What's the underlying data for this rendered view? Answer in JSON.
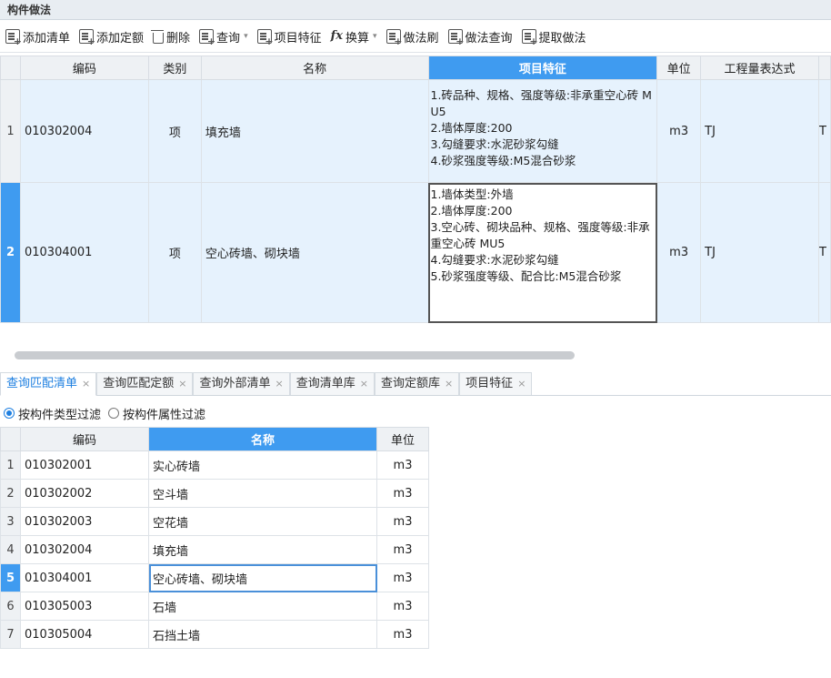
{
  "panel": {
    "title": "构件做法"
  },
  "toolbar": {
    "items": [
      {
        "label": "添加清单",
        "icon": "add-list-icon",
        "dropdown": false
      },
      {
        "label": "添加定额",
        "icon": "add-quota-icon",
        "dropdown": false
      },
      {
        "label": "删除",
        "icon": "trash-icon",
        "dropdown": false
      },
      {
        "label": "查询",
        "icon": "query-icon",
        "dropdown": true
      },
      {
        "label": "项目特征",
        "icon": "feature-icon",
        "dropdown": false
      },
      {
        "label": "换算",
        "icon": "fx-icon",
        "dropdown": true
      },
      {
        "label": "做法刷",
        "icon": "brush-icon",
        "dropdown": false
      },
      {
        "label": "做法查询",
        "icon": "method-query-icon",
        "dropdown": false
      },
      {
        "label": "提取做法",
        "icon": "extract-icon",
        "dropdown": false
      }
    ]
  },
  "main_table": {
    "headers": [
      "编码",
      "类别",
      "名称",
      "项目特征",
      "单位",
      "工程量表达式",
      ""
    ],
    "selected_header": "项目特征",
    "rows": [
      {
        "index": "1",
        "code": "010302004",
        "category": "项",
        "name": "填充墙",
        "features": "1.砖品种、规格、强度等级:非承重空心砖 MU5\n2.墙体厚度:200\n3.勾缝要求:水泥砂浆勾缝\n4.砂浆强度等级:M5混合砂浆",
        "unit": "m3",
        "expression": "TJ",
        "extra": "T"
      },
      {
        "index": "2",
        "code": "010304001",
        "category": "项",
        "name": "空心砖墙、砌块墙",
        "features": "1.墙体类型:外墙\n2.墙体厚度:200\n3.空心砖、砌块品种、规格、强度等级:非承重空心砖 MU5\n4.勾缝要求:水泥砂浆勾缝\n5.砂浆强度等级、配合比:M5混合砂浆",
        "unit": "m3",
        "expression": "TJ",
        "extra": "T"
      }
    ],
    "active_row": "2"
  },
  "tabs": [
    {
      "label": "查询匹配清单",
      "active": true
    },
    {
      "label": "查询匹配定额",
      "active": false
    },
    {
      "label": "查询外部清单",
      "active": false
    },
    {
      "label": "查询清单库",
      "active": false
    },
    {
      "label": "查询定额库",
      "active": false
    },
    {
      "label": "项目特征",
      "active": false
    }
  ],
  "filters": [
    {
      "label": "按构件类型过滤",
      "checked": true
    },
    {
      "label": "按构件属性过滤",
      "checked": false
    }
  ],
  "sub_table": {
    "headers": [
      "编码",
      "名称",
      "单位"
    ],
    "selected_header": "名称",
    "rows": [
      {
        "index": "1",
        "code": "010302001",
        "name": "实心砖墙",
        "unit": "m3"
      },
      {
        "index": "2",
        "code": "010302002",
        "name": "空斗墙",
        "unit": "m3"
      },
      {
        "index": "3",
        "code": "010302003",
        "name": "空花墙",
        "unit": "m3"
      },
      {
        "index": "4",
        "code": "010302004",
        "name": "填充墙",
        "unit": "m3"
      },
      {
        "index": "5",
        "code": "010304001",
        "name": "空心砖墙、砌块墙",
        "unit": "m3"
      },
      {
        "index": "6",
        "code": "010305003",
        "name": "石墙",
        "unit": "m3"
      },
      {
        "index": "7",
        "code": "010305004",
        "name": "石挡土墙",
        "unit": "m3"
      }
    ],
    "active_row": "5"
  },
  "colors": {
    "accent": "#3f9bf0",
    "row_highlight": "#e6f2fd",
    "tab_active": "#1e7fe0"
  }
}
